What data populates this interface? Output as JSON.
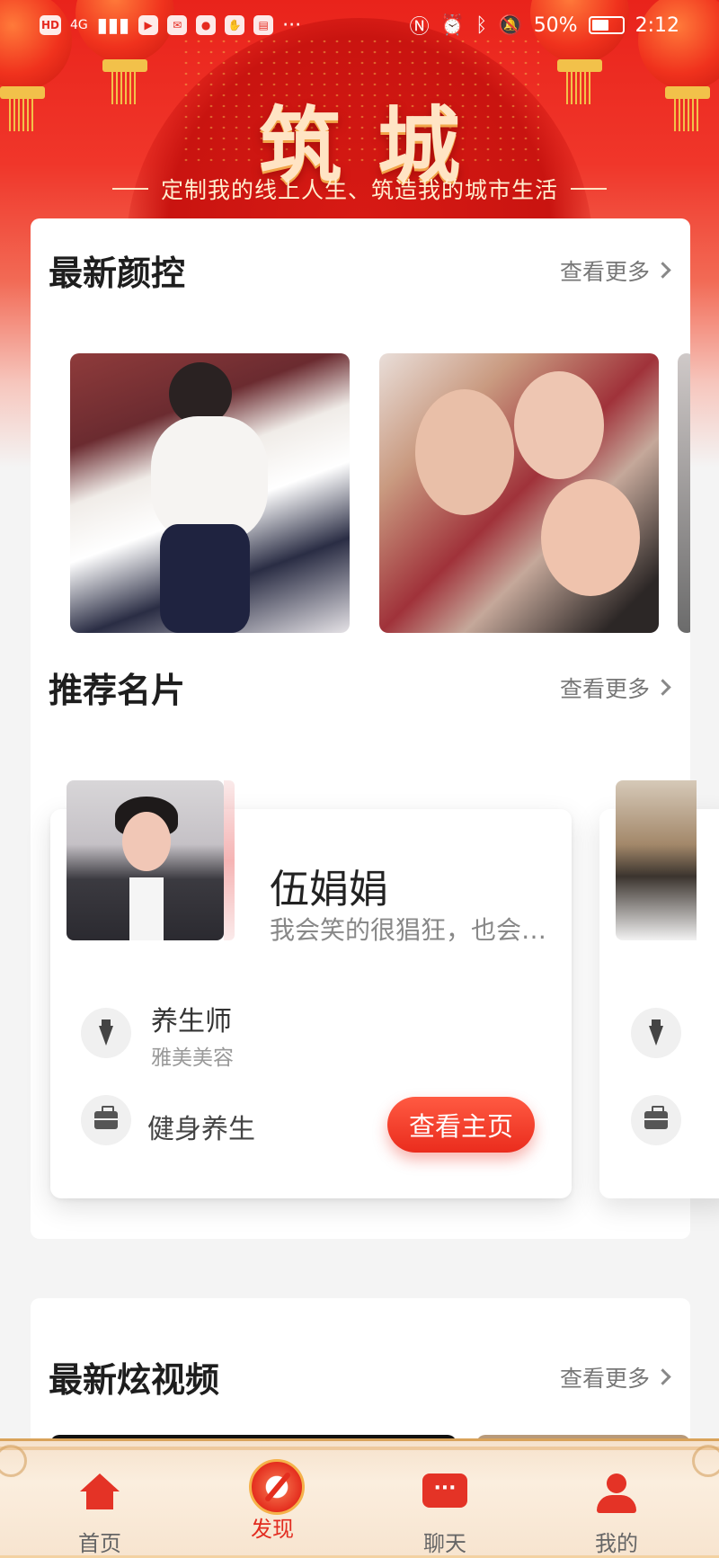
{
  "status_bar": {
    "left_icons": [
      "HD",
      "4G",
      "signal",
      "play",
      "mail",
      "bulb",
      "hand",
      "book",
      "···"
    ],
    "battery": "50%",
    "time": "2:12"
  },
  "header": {
    "brand": "筑城",
    "tagline": "定制我的线上人生、筑造我的城市生活",
    "colors": {
      "primary": "#e9231b",
      "gold": "#f5c24e"
    }
  },
  "sections": {
    "latest_looks": {
      "title": "最新颜控",
      "more": "查看更多"
    },
    "recommended_cards": {
      "title": "推荐名片",
      "more": "查看更多"
    },
    "latest_videos": {
      "title": "最新炫视频",
      "more": "查看更多"
    }
  },
  "namecard": {
    "name": "伍娟娟",
    "bio": "我会笑的很猖狂，也会…",
    "role": "养生师",
    "org": "雅美美容",
    "category": "健身养生",
    "button": "查看主页"
  },
  "bottom_nav": [
    {
      "label": "首页",
      "icon": "home-icon",
      "active": false
    },
    {
      "label": "发现",
      "icon": "compass-icon",
      "active": true
    },
    {
      "label": "聊天",
      "icon": "chat-icon",
      "active": false
    },
    {
      "label": "我的",
      "icon": "user-icon",
      "active": false
    }
  ]
}
